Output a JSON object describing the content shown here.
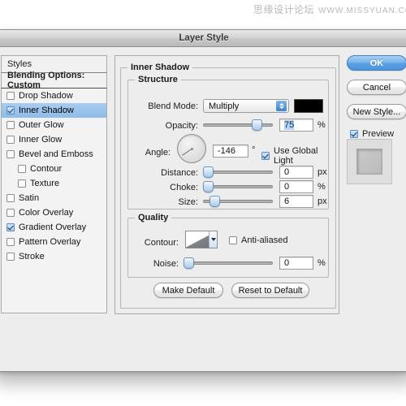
{
  "watermark": {
    "text": "思缘设计论坛",
    "url": "WWW.MISSYUAN.COM"
  },
  "window": {
    "title": "Layer Style"
  },
  "styles_panel": {
    "header": "Styles",
    "blending_options": "Blending Options: Custom",
    "effects": [
      {
        "label": "Drop Shadow",
        "checked": false,
        "selected": false,
        "indent": false
      },
      {
        "label": "Inner Shadow",
        "checked": true,
        "selected": true,
        "indent": false
      },
      {
        "label": "Outer Glow",
        "checked": false,
        "selected": false,
        "indent": false
      },
      {
        "label": "Inner Glow",
        "checked": false,
        "selected": false,
        "indent": false
      },
      {
        "label": "Bevel and Emboss",
        "checked": false,
        "selected": false,
        "indent": false
      },
      {
        "label": "Contour",
        "checked": false,
        "selected": false,
        "indent": true
      },
      {
        "label": "Texture",
        "checked": false,
        "selected": false,
        "indent": true
      },
      {
        "label": "Satin",
        "checked": false,
        "selected": false,
        "indent": false
      },
      {
        "label": "Color Overlay",
        "checked": false,
        "selected": false,
        "indent": false
      },
      {
        "label": "Gradient Overlay",
        "checked": true,
        "selected": false,
        "indent": false
      },
      {
        "label": "Pattern Overlay",
        "checked": false,
        "selected": false,
        "indent": false
      },
      {
        "label": "Stroke",
        "checked": false,
        "selected": false,
        "indent": false
      }
    ]
  },
  "panel": {
    "title": "Inner Shadow",
    "structure": {
      "legend": "Structure",
      "blend_mode_label": "Blend Mode:",
      "blend_mode_value": "Multiply",
      "shadow_color": "#000000",
      "opacity_label": "Opacity:",
      "opacity_value": "75",
      "opacity_unit": "%",
      "angle_label": "Angle:",
      "angle_value": "-146",
      "angle_unit": "°",
      "use_global_light": "Use Global Light",
      "use_global_light_checked": true,
      "distance_label": "Distance:",
      "distance_value": "0",
      "distance_unit": "px",
      "choke_label": "Choke:",
      "choke_value": "0",
      "choke_unit": "%",
      "size_label": "Size:",
      "size_value": "6",
      "size_unit": "px"
    },
    "quality": {
      "legend": "Quality",
      "contour_label": "Contour:",
      "anti_aliased": "Anti-aliased",
      "anti_aliased_checked": false,
      "noise_label": "Noise:",
      "noise_value": "0",
      "noise_unit": "%"
    },
    "make_default": "Make Default",
    "reset_to_default": "Reset to Default"
  },
  "actions": {
    "ok": "OK",
    "cancel": "Cancel",
    "new_style": "New Style...",
    "preview": "Preview",
    "preview_checked": true
  },
  "colors": {
    "accent": "#4b94dc",
    "selection": "#8fbce8",
    "swatch": "#000000"
  }
}
